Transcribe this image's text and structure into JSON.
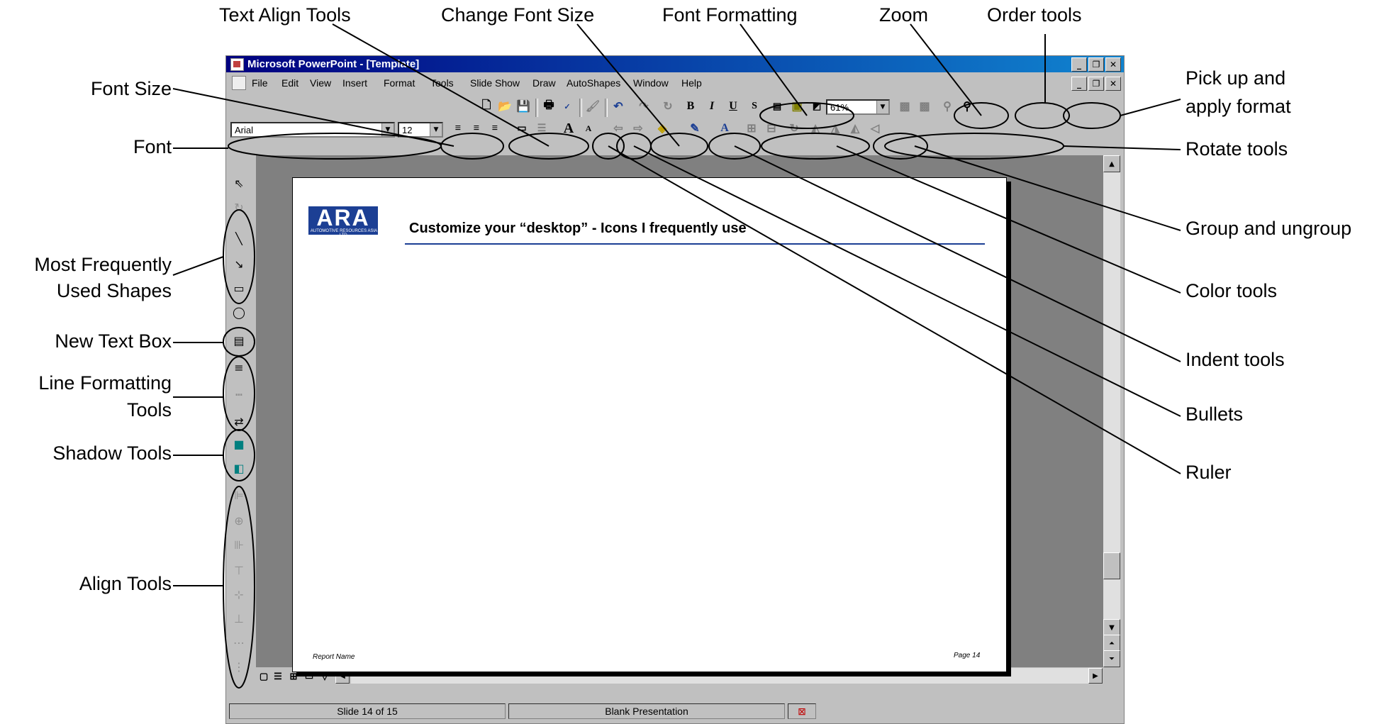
{
  "window": {
    "title": "Microsoft PowerPoint - [Template]",
    "minimize": "_",
    "restore": "❐",
    "close": "✕"
  },
  "menu": [
    "File",
    "Edit",
    "View",
    "Insert",
    "Format",
    "Tools",
    "Slide Show",
    "Draw",
    "AutoShapes",
    "Window",
    "Help"
  ],
  "formatting": {
    "font": "Arial",
    "font_size": "12",
    "zoom": "61%"
  },
  "slide": {
    "logo": "ARA",
    "logo_tagline": "AUTOMOTIVE RESOURCES ASIA LTD.",
    "title": "Customize your “desktop” - Icons I frequently use",
    "footer_name": "Report Name",
    "footer_page": "Page 14"
  },
  "status": {
    "slide": "Slide 14 of 15",
    "design": "Blank Presentation"
  },
  "callouts": {
    "text_align_tools": "Text Align Tools",
    "change_font_size": "Change Font Size",
    "font_formatting": "Font Formatting",
    "zoom": "Zoom",
    "order_tools": "Order tools",
    "pick_up_line1": "Pick up and",
    "pick_up_line2": "apply format",
    "font_size": "Font Size",
    "font": "Font",
    "rotate_tools": "Rotate tools",
    "group_ungroup": "Group and ungroup",
    "color_tools": "Color tools",
    "indent_tools": "Indent tools",
    "bullets": "Bullets",
    "ruler": "Ruler",
    "most_used_line1": "Most Frequently",
    "most_used_line2": "Used Shapes",
    "new_text_box": "New Text Box",
    "line_format_line1": "Line Formatting",
    "line_format_line2": "Tools",
    "shadow_tools": "Shadow Tools",
    "align_tools": "Align Tools"
  }
}
